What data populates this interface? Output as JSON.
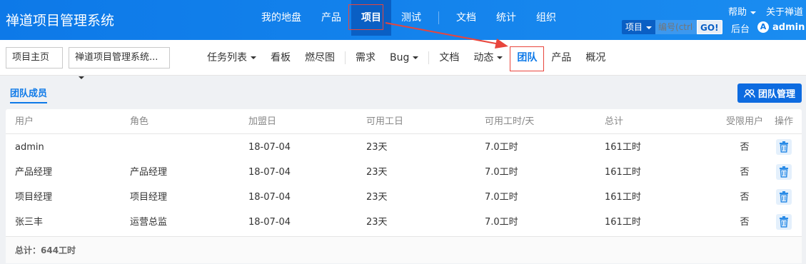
{
  "app": {
    "title": "禅道项目管理系统"
  },
  "main_nav": [
    {
      "label": "我的地盘"
    },
    {
      "label": "产品"
    },
    {
      "label": "项目",
      "active": true
    },
    {
      "label": "测试"
    },
    {
      "label": "文档"
    },
    {
      "label": "统计"
    },
    {
      "label": "组织"
    }
  ],
  "top_right": {
    "help": "帮助",
    "about": "关于禅道",
    "backend": "后台",
    "user": "admin",
    "avatar_letter": "A"
  },
  "search": {
    "scope": "项目",
    "placeholder": "编号(ctrl+g)",
    "go": "GO!"
  },
  "breadcrumb": {
    "home": "项目主页",
    "project": "禅道项目管理系统..."
  },
  "sub_nav": [
    {
      "label": "任务列表",
      "dropdown": true
    },
    {
      "label": "看板"
    },
    {
      "label": "燃尽图"
    },
    {
      "label": "需求"
    },
    {
      "label": "Bug",
      "dropdown": true
    },
    {
      "label": "文档"
    },
    {
      "label": "动态",
      "dropdown": true
    },
    {
      "label": "团队",
      "active": true
    },
    {
      "label": "产品"
    },
    {
      "label": "概况"
    }
  ],
  "page": {
    "tab": "团队成员",
    "manage_button": "团队管理"
  },
  "table": {
    "headers": {
      "user": "用户",
      "role": "角色",
      "join": "加盟日",
      "days": "可用工日",
      "hours": "可用工时/天",
      "total": "总计",
      "limited": "受限用户",
      "actions": "操作"
    },
    "rows": [
      {
        "user": "admin",
        "role": "",
        "join": "18-07-04",
        "days": "23天",
        "hours": "7.0工时",
        "total": "161工时",
        "limited": "否"
      },
      {
        "user": "产品经理",
        "role": "产品经理",
        "join": "18-07-04",
        "days": "23天",
        "hours": "7.0工时",
        "total": "161工时",
        "limited": "否"
      },
      {
        "user": "项目经理",
        "role": "项目经理",
        "join": "18-07-04",
        "days": "23天",
        "hours": "7.0工时",
        "total": "161工时",
        "limited": "否"
      },
      {
        "user": "张三丰",
        "role": "运营总监",
        "join": "18-07-04",
        "days": "23天",
        "hours": "7.0工时",
        "total": "161工时",
        "limited": "否"
      }
    ],
    "footer": "总计：644工时"
  },
  "colors": {
    "topbar": "#0d79e8",
    "accent": "#0d79e8",
    "annotation": "#e8453c"
  },
  "icons": {
    "delete": "trash-icon",
    "team": "users-icon"
  }
}
